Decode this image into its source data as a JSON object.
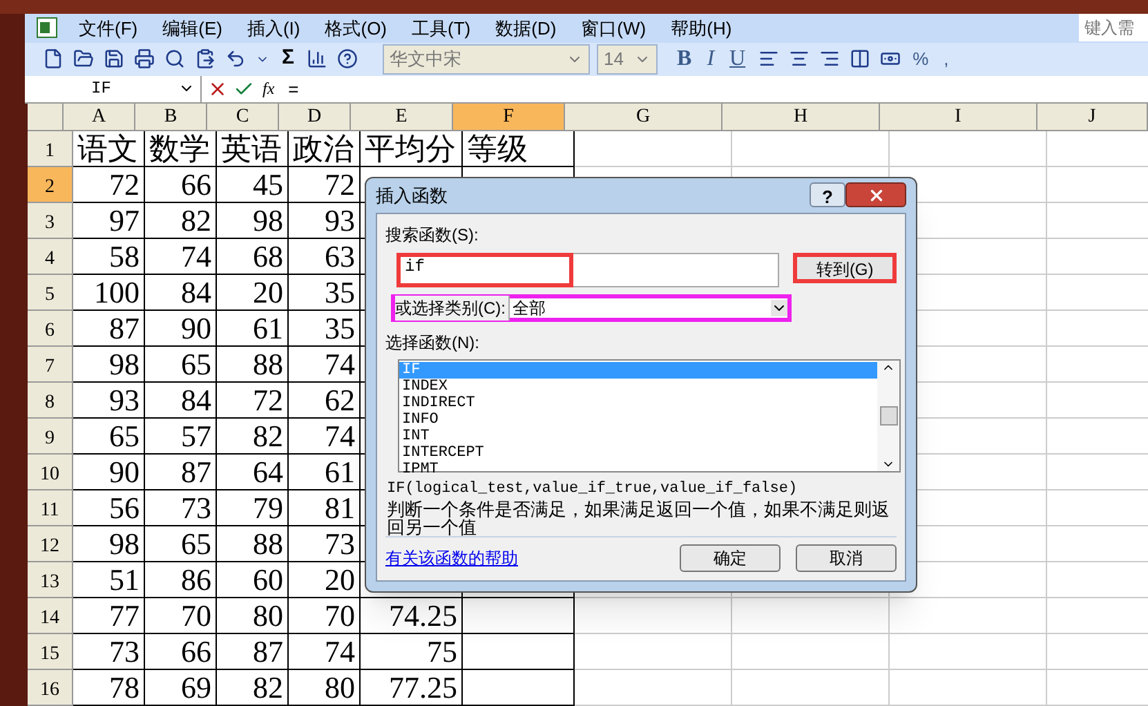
{
  "menu": [
    "文件(F)",
    "编辑(E)",
    "插入(I)",
    "格式(O)",
    "工具(T)",
    "数据(D)",
    "窗口(W)",
    "帮助(H)"
  ],
  "help_search": {
    "placeholder": "键入需"
  },
  "toolbar": {
    "sum": "Σ",
    "font": "华文中宋",
    "size": "14",
    "bold": "B",
    "italic": "I",
    "underline": "U",
    "percent": "%",
    "comma": ","
  },
  "formula_bar": {
    "name_box": "IF",
    "fx": "fx",
    "formula": "="
  },
  "sheet": {
    "columns": [
      {
        "label": "A",
        "selected": false
      },
      {
        "label": "B",
        "selected": false
      },
      {
        "label": "C",
        "selected": false
      },
      {
        "label": "D",
        "selected": false
      },
      {
        "label": "E",
        "selected": false
      },
      {
        "label": "F",
        "selected": true
      },
      {
        "label": "G",
        "selected": false
      },
      {
        "label": "H",
        "selected": false
      },
      {
        "label": "I",
        "selected": false
      },
      {
        "label": "J",
        "selected": false
      }
    ],
    "rows": [
      {
        "label": "1",
        "selected": false,
        "cells": [
          "语文",
          "数学",
          "英语",
          "政治",
          "平均分",
          "等级"
        ]
      },
      {
        "label": "2",
        "selected": true,
        "cells": [
          "72",
          "66",
          "45",
          "72"
        ]
      },
      {
        "label": "3",
        "selected": false,
        "cells": [
          "97",
          "82",
          "98",
          "93"
        ]
      },
      {
        "label": "4",
        "selected": false,
        "cells": [
          "58",
          "74",
          "68",
          "63"
        ]
      },
      {
        "label": "5",
        "selected": false,
        "cells": [
          "100",
          "84",
          "20",
          "35"
        ]
      },
      {
        "label": "6",
        "selected": false,
        "cells": [
          "87",
          "90",
          "61",
          "35"
        ]
      },
      {
        "label": "7",
        "selected": false,
        "cells": [
          "98",
          "65",
          "88",
          "74"
        ]
      },
      {
        "label": "8",
        "selected": false,
        "cells": [
          "93",
          "84",
          "72",
          "62"
        ]
      },
      {
        "label": "9",
        "selected": false,
        "cells": [
          "65",
          "57",
          "82",
          "74"
        ]
      },
      {
        "label": "10",
        "selected": false,
        "cells": [
          "90",
          "87",
          "64",
          "61"
        ]
      },
      {
        "label": "11",
        "selected": false,
        "cells": [
          "56",
          "73",
          "79",
          "81"
        ]
      },
      {
        "label": "12",
        "selected": false,
        "cells": [
          "98",
          "65",
          "88",
          "73"
        ]
      },
      {
        "label": "13",
        "selected": false,
        "cells": [
          "51",
          "86",
          "60",
          "20"
        ]
      },
      {
        "label": "14",
        "selected": false,
        "cells": [
          "77",
          "70",
          "80",
          "70",
          "74.25"
        ]
      },
      {
        "label": "15",
        "selected": false,
        "cells": [
          "73",
          "66",
          "87",
          "74",
          "75"
        ]
      },
      {
        "label": "16",
        "selected": false,
        "cells": [
          "78",
          "69",
          "82",
          "80",
          "77.25"
        ]
      }
    ]
  },
  "dialog": {
    "title": "插入函数",
    "help": "?",
    "search_label": "搜索函数(S):",
    "search_value": "if",
    "go_button": "转到(G)",
    "category_label": "或选择类别(C):",
    "category_value": "全部",
    "list_label": "选择函数(N):",
    "functions": [
      {
        "name": "IF",
        "selected": true
      },
      {
        "name": "INDEX",
        "selected": false
      },
      {
        "name": "INDIRECT",
        "selected": false
      },
      {
        "name": "INFO",
        "selected": false
      },
      {
        "name": "INT",
        "selected": false
      },
      {
        "name": "INTERCEPT",
        "selected": false
      },
      {
        "name": "IPMT",
        "selected": false
      }
    ],
    "syntax": "IF(logical_test,value_if_true,value_if_false)",
    "description": "判断一个条件是否满足，如果满足返回一个值，如果不满足则返回另一个值",
    "help_link": "有关该函数的帮助",
    "ok": "确定",
    "cancel": "取消"
  }
}
